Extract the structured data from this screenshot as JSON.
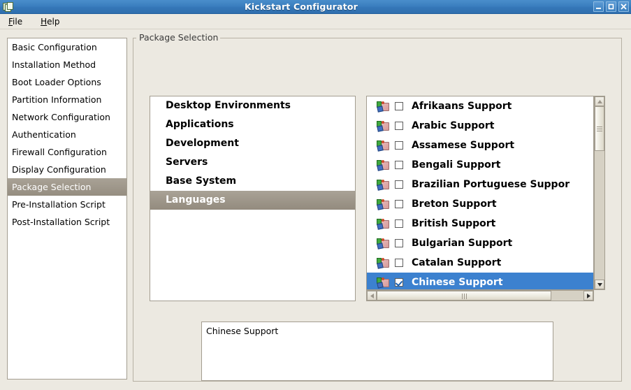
{
  "window": {
    "title": "Kickstart Configurator",
    "app_icon": "kickstart-icon",
    "controls": {
      "minimize": "minimize-icon",
      "maximize": "maximize-icon",
      "close": "close-icon"
    }
  },
  "menubar": {
    "items": [
      {
        "label": "File",
        "mnemonic": "F"
      },
      {
        "label": "Help",
        "mnemonic": "H"
      }
    ]
  },
  "sidebar": {
    "items": [
      {
        "label": "Basic Configuration",
        "selected": false
      },
      {
        "label": "Installation Method",
        "selected": false
      },
      {
        "label": "Boot Loader Options",
        "selected": false
      },
      {
        "label": "Partition Information",
        "selected": false
      },
      {
        "label": "Network Configuration",
        "selected": false
      },
      {
        "label": "Authentication",
        "selected": false
      },
      {
        "label": "Firewall Configuration",
        "selected": false
      },
      {
        "label": "Display Configuration",
        "selected": false
      },
      {
        "label": "Package Selection",
        "selected": true
      },
      {
        "label": "Pre-Installation Script",
        "selected": false
      },
      {
        "label": "Post-Installation Script",
        "selected": false
      }
    ]
  },
  "main": {
    "groupbox_legend": "Package Selection",
    "group_list": [
      {
        "label": "Desktop Environments",
        "selected": false
      },
      {
        "label": "Applications",
        "selected": false
      },
      {
        "label": "Development",
        "selected": false
      },
      {
        "label": "Servers",
        "selected": false
      },
      {
        "label": "Base System",
        "selected": false
      },
      {
        "label": "Languages",
        "selected": true
      }
    ],
    "package_list": [
      {
        "label": "Afrikaans Support",
        "checked": false,
        "selected": false,
        "icon": "package-icon"
      },
      {
        "label": "Arabic Support",
        "checked": false,
        "selected": false,
        "icon": "package-icon"
      },
      {
        "label": "Assamese Support",
        "checked": false,
        "selected": false,
        "icon": "package-icon"
      },
      {
        "label": "Bengali Support",
        "checked": false,
        "selected": false,
        "icon": "package-icon"
      },
      {
        "label": "Brazilian Portuguese Suppor",
        "checked": false,
        "selected": false,
        "icon": "package-icon"
      },
      {
        "label": "Breton Support",
        "checked": false,
        "selected": false,
        "icon": "package-icon"
      },
      {
        "label": "British Support",
        "checked": false,
        "selected": false,
        "icon": "package-icon"
      },
      {
        "label": "Bulgarian Support",
        "checked": false,
        "selected": false,
        "icon": "package-icon"
      },
      {
        "label": "Catalan Support",
        "checked": false,
        "selected": false,
        "icon": "package-icon"
      },
      {
        "label": "Chinese Support",
        "checked": true,
        "selected": true,
        "icon": "package-icon"
      }
    ],
    "description": "Chinese Support"
  },
  "colors": {
    "titlebar_blue": "#3b7fbf",
    "selection_blue": "#3c81cf",
    "selection_taupe": "#9d9689",
    "window_bg": "#ece9e1",
    "border": "#a39d90"
  }
}
